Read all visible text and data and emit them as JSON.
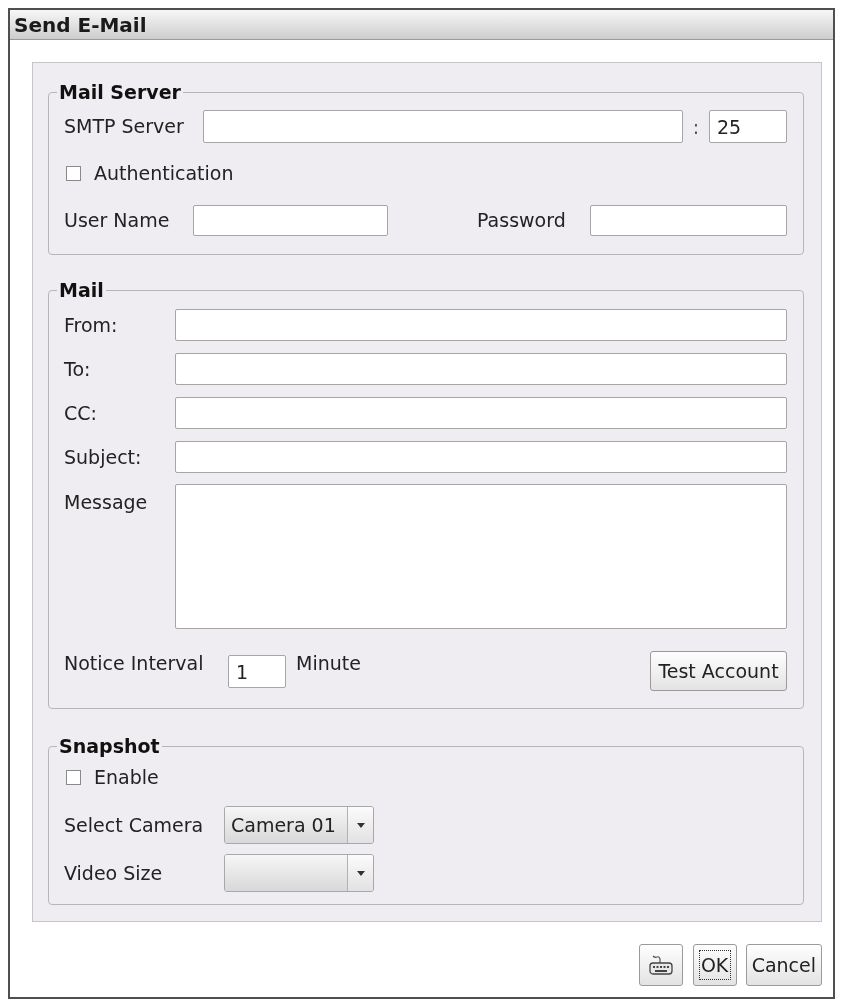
{
  "window": {
    "title": "Send E-Mail"
  },
  "mail_server": {
    "legend": "Mail Server",
    "smtp_label": "SMTP Server",
    "separator": ":",
    "port": "25",
    "authentication": {
      "label": "Authentication",
      "checked": false
    },
    "user_name_label": "User Name",
    "password_label": "Password"
  },
  "mail": {
    "legend": "Mail",
    "fields": [
      {
        "kind": "line",
        "label": "From:"
      },
      {
        "kind": "line",
        "label": "To:"
      },
      {
        "kind": "line",
        "label": "CC:"
      },
      {
        "kind": "line",
        "label": "Subject:"
      },
      {
        "kind": "multiline",
        "label": "Message"
      }
    ],
    "notice_label": "Notice Interval",
    "interval": "1",
    "unit": "Minute",
    "test_button": "Test Account"
  },
  "snapshot": {
    "legend": "Snapshot",
    "enable": {
      "label": "Enable",
      "checked": false
    },
    "selects": [
      {
        "label": "Select Camera",
        "value": "Camera 01"
      },
      {
        "label": "Video Size"
      }
    ]
  },
  "buttons": [
    {
      "kind": "icon",
      "focused": false
    },
    {
      "kind": "text",
      "label": "OK",
      "focused": true
    },
    {
      "kind": "text",
      "label": "Cancel",
      "focused": false
    }
  ]
}
